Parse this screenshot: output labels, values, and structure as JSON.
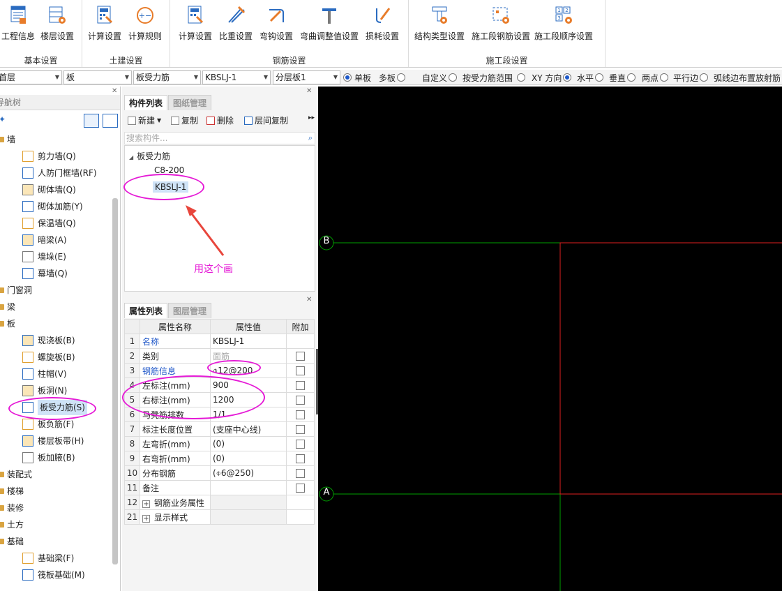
{
  "ribbon": {
    "groups": [
      {
        "label": "基本设置",
        "buttons": [
          "工程信息",
          "楼层设置"
        ]
      },
      {
        "label": "土建设置",
        "buttons": [
          "计算设置",
          "计算规则"
        ]
      },
      {
        "label": "钢筋设置",
        "buttons": [
          "计算设置",
          "比重设置",
          "弯钩设置",
          "弯曲调整值设置",
          "损耗设置"
        ]
      },
      {
        "label": "施工段设置",
        "buttons": [
          "结构类型设置",
          "施工段钢筋设置",
          "施工段顺序设置"
        ]
      }
    ]
  },
  "filterbar": {
    "floor": "首层",
    "category": "板",
    "type": "板受力筋",
    "component": "KBSLJ-1",
    "layer": "分层板1",
    "radios": [
      {
        "label": "单板",
        "checked": true
      },
      {
        "label": "多板",
        "checked": false
      },
      {
        "label": "自定义",
        "checked": false
      },
      {
        "label": "按受力筋范围",
        "checked": false
      },
      {
        "label": "XY 方向",
        "checked": true
      },
      {
        "label": "水平",
        "checked": false
      },
      {
        "label": "垂直",
        "checked": false
      },
      {
        "label": "两点",
        "checked": false
      },
      {
        "label": "平行边",
        "checked": false
      },
      {
        "label": "弧线边布置放射筋",
        "checked": false
      }
    ]
  },
  "nav": {
    "title": "导航树",
    "items": [
      {
        "label": "墙",
        "level": 0
      },
      {
        "label": "剪力墙(Q)",
        "level": 1,
        "icon": "shear-wall-icon"
      },
      {
        "label": "人防门框墙(RF)",
        "level": 1,
        "icon": "door-frame-wall-icon"
      },
      {
        "label": "砌体墙(Q)",
        "level": 1,
        "icon": "masonry-wall-icon"
      },
      {
        "label": "砌体加筋(Y)",
        "level": 1,
        "icon": "masonry-rebar-icon"
      },
      {
        "label": "保温墙(Q)",
        "level": 1,
        "icon": "insulation-wall-icon"
      },
      {
        "label": "暗梁(A)",
        "level": 1,
        "icon": "hidden-beam-icon"
      },
      {
        "label": "墙垛(E)",
        "level": 1,
        "icon": "wall-pier-icon"
      },
      {
        "label": "幕墙(Q)",
        "level": 1,
        "icon": "curtain-wall-icon"
      },
      {
        "label": "门窗洞",
        "level": 0
      },
      {
        "label": "梁",
        "level": 0
      },
      {
        "label": "板",
        "level": 0
      },
      {
        "label": "现浇板(B)",
        "level": 1,
        "icon": "cast-slab-icon"
      },
      {
        "label": "螺旋板(B)",
        "level": 1,
        "icon": "spiral-slab-icon"
      },
      {
        "label": "柱帽(V)",
        "level": 1,
        "icon": "column-cap-icon"
      },
      {
        "label": "板洞(N)",
        "level": 1,
        "icon": "slab-hole-icon"
      },
      {
        "label": "板受力筋(S)",
        "level": 1,
        "icon": "slab-rebar-icon",
        "selected": true
      },
      {
        "label": "板负筋(F)",
        "level": 1,
        "icon": "negative-rebar-icon"
      },
      {
        "label": "楼层板带(H)",
        "level": 1,
        "icon": "slab-strip-icon"
      },
      {
        "label": "板加腋(B)",
        "level": 1,
        "icon": "slab-haunch-icon"
      },
      {
        "label": "装配式",
        "level": 0
      },
      {
        "label": "楼梯",
        "level": 0
      },
      {
        "label": "装修",
        "level": 0
      },
      {
        "label": "土方",
        "level": 0
      },
      {
        "label": "基础",
        "level": 0
      },
      {
        "label": "基础梁(F)",
        "level": 1,
        "icon": "foundation-beam-icon"
      },
      {
        "label": "筏板基础(M)",
        "level": 1,
        "icon": "raft-foundation-icon"
      }
    ]
  },
  "components": {
    "tabs": [
      "构件列表",
      "图纸管理"
    ],
    "toolbar": [
      "新建",
      "复制",
      "删除",
      "层间复制"
    ],
    "search_placeholder": "搜索构件...",
    "group": "板受力筋",
    "items": [
      "C8-200",
      "KBSLJ-1"
    ],
    "selected": "KBSLJ-1",
    "annotation": "用这个画"
  },
  "properties": {
    "tabs": [
      "属性列表",
      "图层管理"
    ],
    "headers": [
      "属性名称",
      "属性值",
      "附加"
    ],
    "rows": [
      {
        "no": "1",
        "name": "名称",
        "value": "KBSLJ-1",
        "name_blue": true,
        "check": false
      },
      {
        "no": "2",
        "name": "类别",
        "value": "面筋",
        "value_grey": true,
        "check": true
      },
      {
        "no": "3",
        "name": "钢筋信息",
        "value": "⌽12@200",
        "name_blue": true,
        "check": true
      },
      {
        "no": "4",
        "name": "左标注(mm)",
        "value": "900",
        "check": true
      },
      {
        "no": "5",
        "name": "右标注(mm)",
        "value": "1200",
        "check": true
      },
      {
        "no": "6",
        "name": "马凳筋排数",
        "value": "1/1",
        "check": true
      },
      {
        "no": "7",
        "name": "标注长度位置",
        "value": "(支座中心线)",
        "check": true
      },
      {
        "no": "8",
        "name": "左弯折(mm)",
        "value": "(0)",
        "check": true
      },
      {
        "no": "9",
        "name": "右弯折(mm)",
        "value": "(0)",
        "check": true
      },
      {
        "no": "10",
        "name": "分布钢筋",
        "value": "(⌽6@250)",
        "check": true
      },
      {
        "no": "11",
        "name": "备注",
        "value": "",
        "check": true
      },
      {
        "no": "12",
        "name": "钢筋业务属性",
        "value": "",
        "expand": true
      },
      {
        "no": "21",
        "name": "显示样式",
        "value": "",
        "expand": true
      }
    ]
  },
  "canvas": {
    "axis_labels": [
      "B",
      "A"
    ],
    "colors": {
      "background": "#000000",
      "grid": "#00a000",
      "slab": "#e02020",
      "marker": "#e51ad6"
    }
  }
}
